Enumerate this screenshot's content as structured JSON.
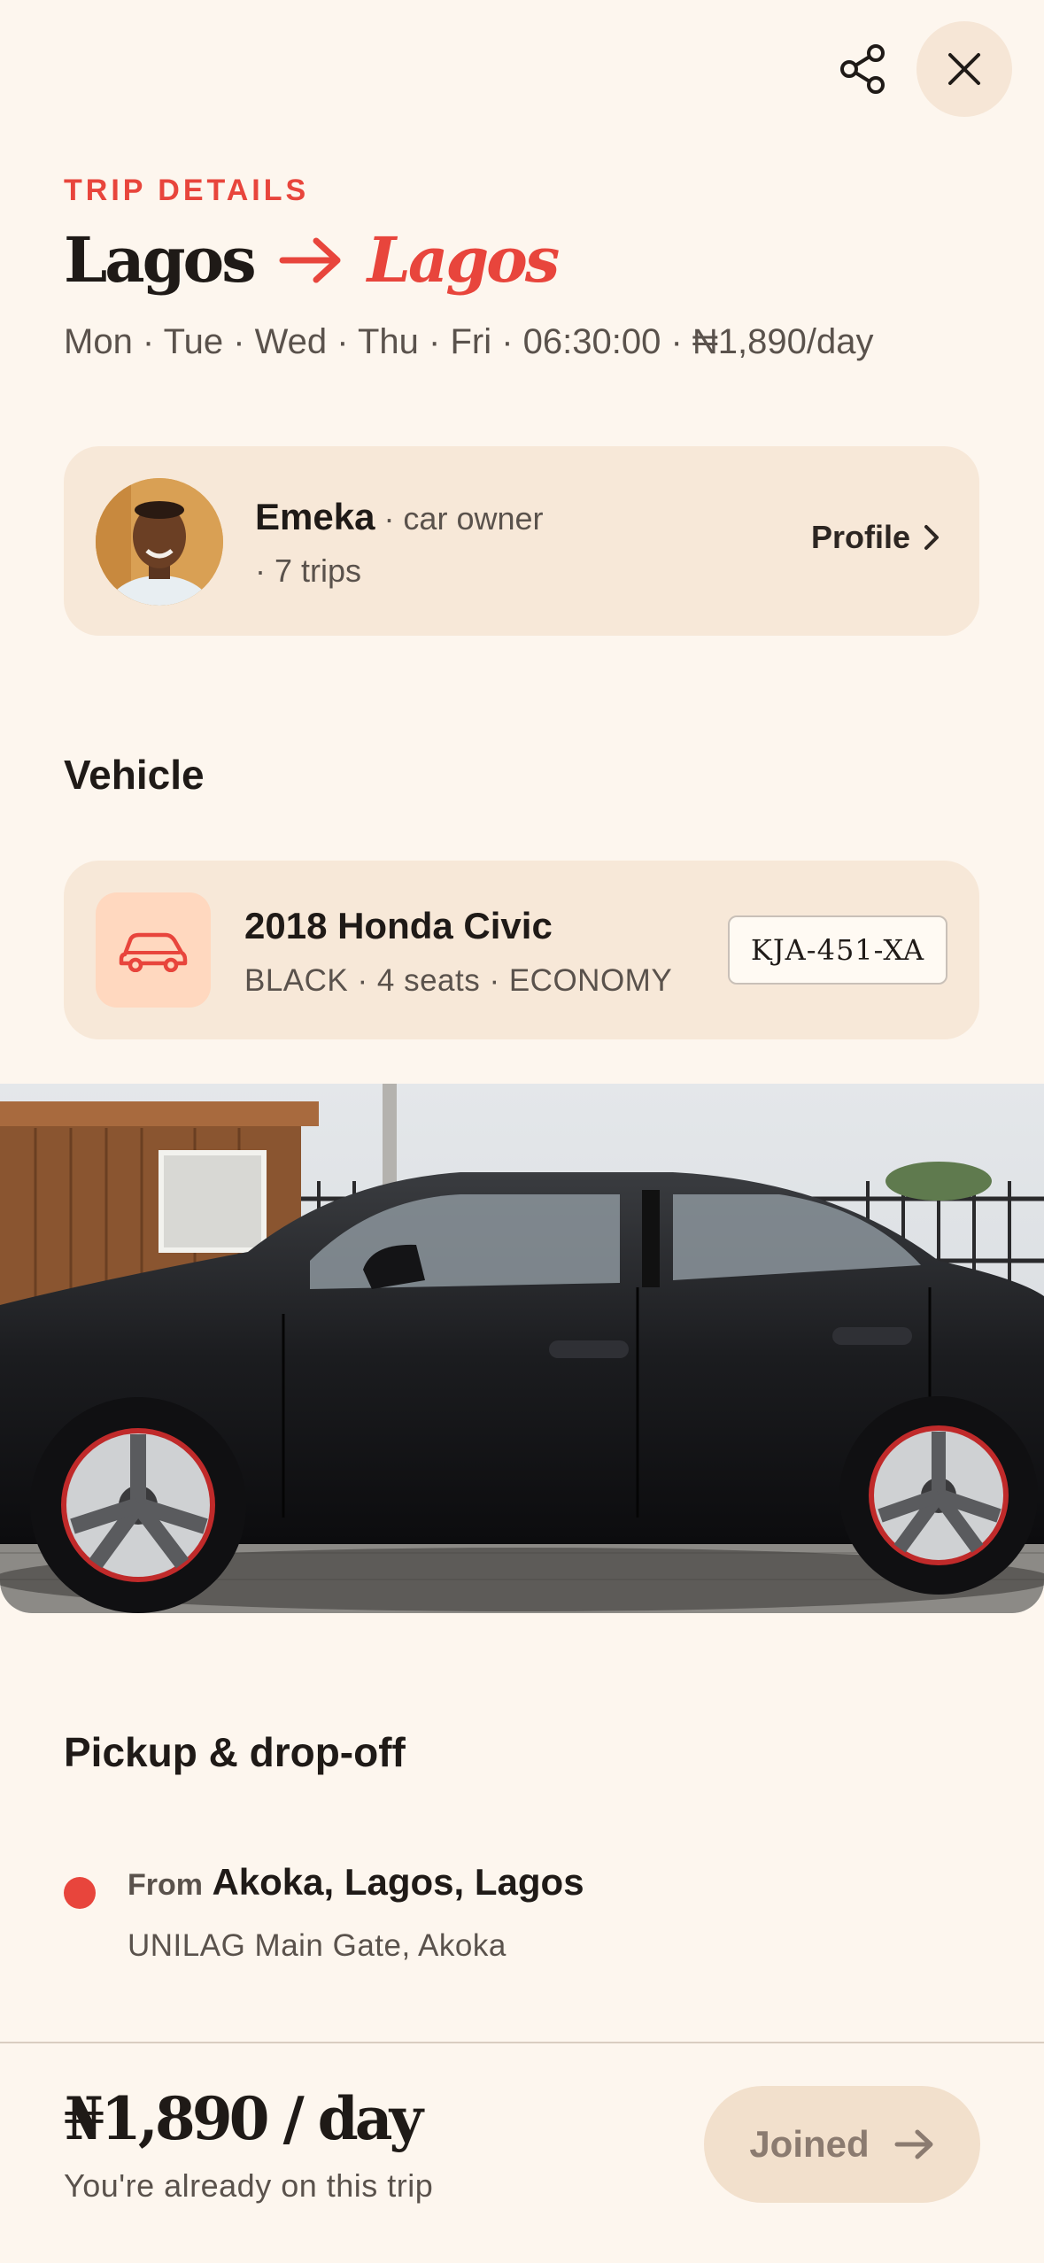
{
  "header": {
    "share_icon": "share-icon",
    "close_icon": "close-icon"
  },
  "trip": {
    "eyebrow": "TRIP DETAILS",
    "from_city": "Lagos",
    "to_city": "Lagos",
    "arrow_icon": "arrow-right-icon",
    "schedule": "Mon · Tue · Wed · Thu · Fri · 06:30:00 · ₦1,890/day"
  },
  "owner": {
    "name": "Emeka",
    "role": " · car owner",
    "trips": "· 7 trips",
    "profile_label": "Profile"
  },
  "vehicle": {
    "section_title": "Vehicle",
    "name": "2018 Honda Civic",
    "meta": "BLACK · 4 seats · ECONOMY",
    "plate": "KJA-451-XA",
    "icon": "car-icon"
  },
  "pickup": {
    "section_title": "Pickup & drop-off",
    "from_label": "From",
    "from_place": "Akoka, Lagos, Lagos",
    "from_sub": "UNILAG Main Gate, Akoka"
  },
  "footer": {
    "price": "₦1,890 / day",
    "note": "You're already on this trip",
    "button_label": "Joined"
  },
  "colors": {
    "accent": "#e8453c",
    "background": "#fdf6ee",
    "card": "#f7e8d8"
  }
}
